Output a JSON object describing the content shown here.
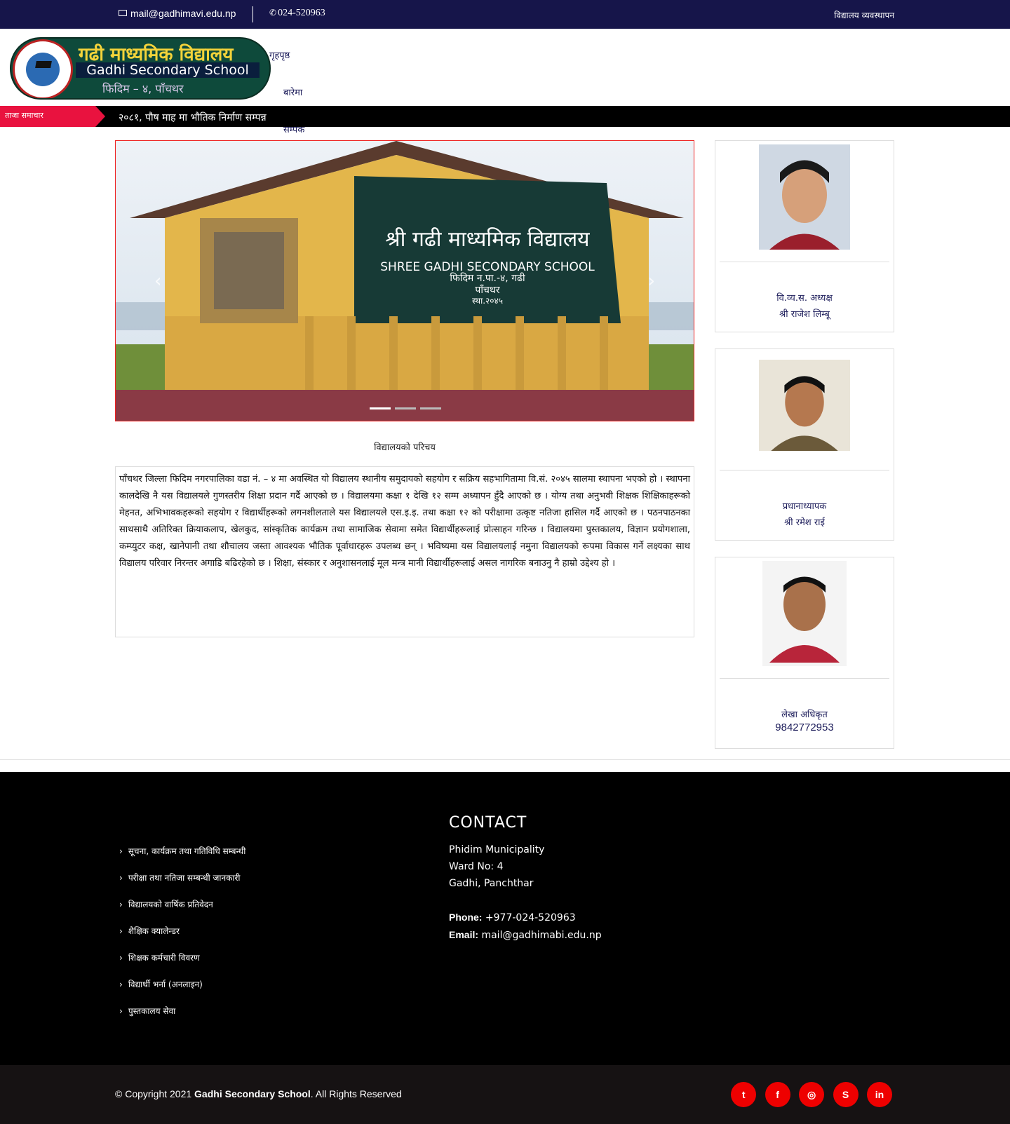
{
  "topbar": {
    "email": "mail@gadhimavi.edu.np",
    "phone": "024-520963",
    "right_link": "विद्यालय व्यवस्थापन"
  },
  "logo": {
    "title_np": "गढी माध्यमिक विद्यालय",
    "title_en": "Gadhi Secondary School",
    "subtitle": "फिदिम – ४, पाँचथर"
  },
  "nav": {
    "items": [
      "गृहपृष्ठ",
      "बारेमा",
      "सम्पर्क"
    ]
  },
  "ticker": {
    "label": "ताजा समाचार",
    "headline": "२०८१, पौष माह मा भौतिक निर्माण सम्पन्न"
  },
  "slider": {
    "sign_line1": "श्री गढी माध्यमिक विद्यालय",
    "sign_line2": "SHREE GADHI SECONDARY SCHOOL",
    "sign_line3": "फिदिम न.पा.-४, गढी",
    "sign_line4": "पाँचथर",
    "sign_line5": "स्था.२०४५",
    "prev": "‹",
    "next": "›"
  },
  "intro": {
    "title": "विद्यालयको परिचय",
    "body": "पाँचथर जिल्ला फिदिम नगरपालिका वडा नं. – ४ मा अवस्थित यो विद्यालय स्थानीय समुदायको सहयोग र सक्रिय सहभागितामा वि.सं. २०४५ सालमा स्थापना भएको हो । स्थापना कालदेखि नै यस विद्यालयले गुणस्तरीय शिक्षा प्रदान गर्दै आएको छ । विद्यालयमा कक्षा १ देखि १२ सम्म अध्यापन हुँदै आएको छ । योग्य तथा अनुभवी शिक्षक शिक्षिकाहरूको मेहनत, अभिभावकहरूको सहयोग र विद्यार्थीहरूको लगनशीलताले यस विद्यालयले एस.इ.इ. तथा कक्षा १२ को परीक्षामा उत्कृष्ट नतिजा हासिल गर्दै आएको छ । पठनपाठनका साथसाथै अतिरिक्त क्रियाकलाप, खेलकुद, सांस्कृतिक कार्यक्रम तथा सामाजिक सेवामा समेत विद्यार्थीहरूलाई प्रोत्साहन गरिन्छ । विद्यालयमा पुस्तकालय, विज्ञान प्रयोगशाला, कम्प्युटर कक्ष, खानेपानी तथा शौचालय जस्ता आवश्यक भौतिक पूर्वाधारहरू उपलब्ध छन् । भविष्यमा यस विद्यालयलाई नमुना विद्यालयको रूपमा विकास गर्ने लक्ष्यका साथ विद्यालय परिवार निरन्तर अगाडि बढिरहेको छ । शिक्षा, संस्कार र अनुशासनलाई मूल मन्त्र मानी विद्यार्थीहरूलाई असल नागरिक बनाउनु नै हाम्रो उद्देश्य हो ।"
  },
  "staff": [
    {
      "name": "वि.व्य.स. अध्यक्ष",
      "role": "श्री राजेश लिम्बू"
    },
    {
      "name": "प्रधानाध्यापक",
      "role": "श्री रमेश राई"
    },
    {
      "name": "लेखा अधिकृत",
      "role": "9842772953"
    }
  ],
  "footer": {
    "links": [
      "सूचना, कार्यक्रम तथा गतिविधि सम्बन्धी",
      "परीक्षा तथा नतिजा सम्बन्धी जानकारी",
      "विद्यालयको वार्षिक प्रतिवेदन",
      "शैक्षिक क्यालेन्डर",
      "शिक्षक कर्मचारी विवरण",
      "विद्यार्थी भर्ना (अनलाइन)",
      "पुस्तकालय सेवा"
    ],
    "contact_title": "CONTACT",
    "address1": "Phidim Municipality",
    "address2": "Ward No: 4",
    "address3": "Gadhi, Panchthar",
    "phone_label": "Phone:",
    "phone": "+977-024-520963",
    "email_label": "Email:",
    "email": "mail@gadhimabi.edu.np"
  },
  "copyright": {
    "prefix": "© Copyright 2021 ",
    "school": "Gadhi Secondary School",
    "suffix": ". All Rights Reserved"
  },
  "social": [
    {
      "icon": "twitter-icon",
      "glyph": "t"
    },
    {
      "icon": "facebook-icon",
      "glyph": "f"
    },
    {
      "icon": "instagram-icon",
      "glyph": "◎"
    },
    {
      "icon": "skype-icon",
      "glyph": "S"
    },
    {
      "icon": "linkedin-icon",
      "glyph": "in"
    }
  ],
  "colors": {
    "topbar": "#16154a",
    "ticker_tag": "#e9123f",
    "social": "#e00000",
    "footer": "#000000"
  }
}
